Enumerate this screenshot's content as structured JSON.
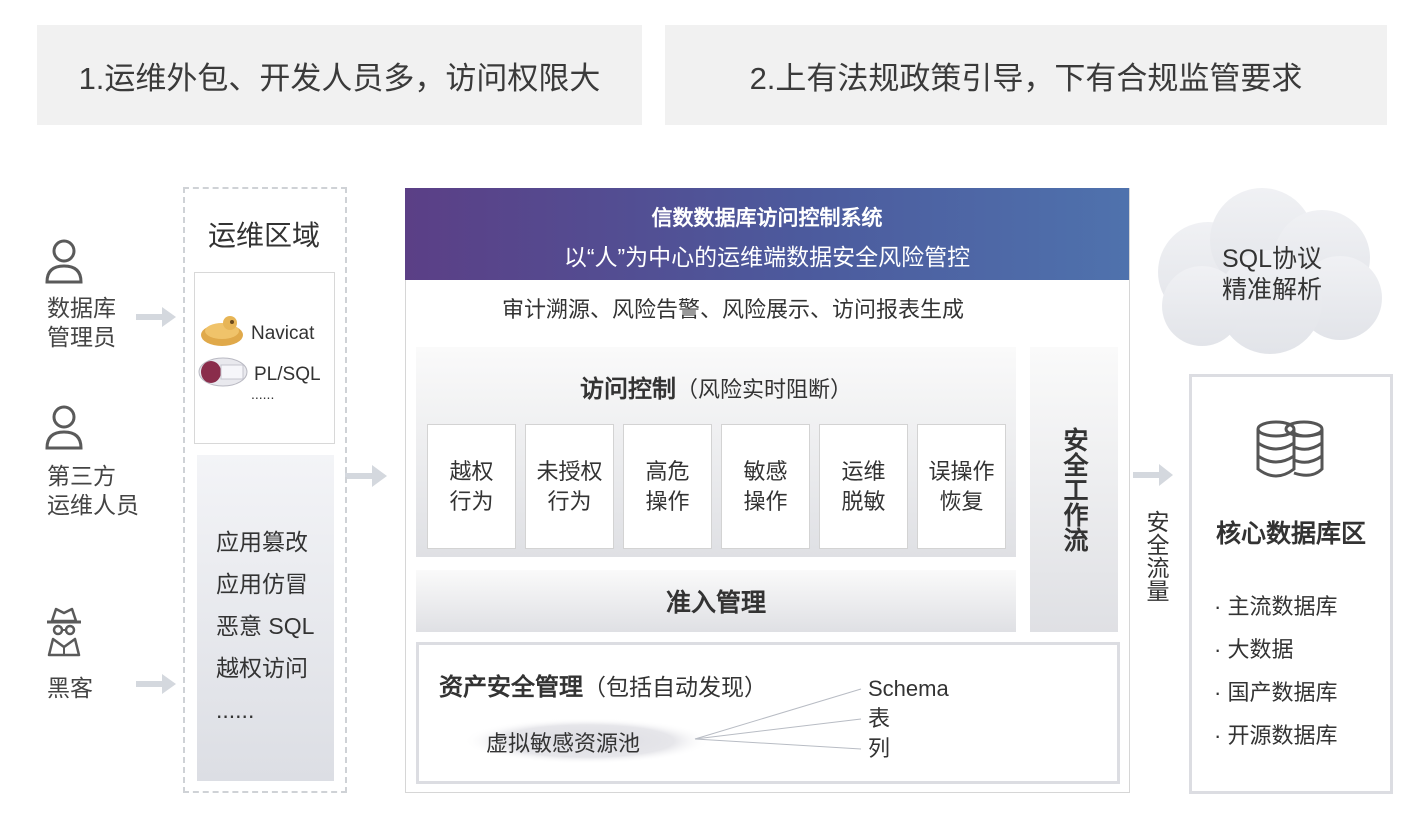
{
  "header": {
    "left_text": "1.运维外包、开发人员多，访问权限大",
    "right_text": "2.上有法规政策引导，下有合规监管要求"
  },
  "users": [
    {
      "label_line1": "数据库",
      "label_line2": "管理员",
      "icon": "person-icon"
    },
    {
      "label_line1": "第三方",
      "label_line2": "运维人员",
      "icon": "person-icon"
    },
    {
      "label_line1": "黑客",
      "label_line2": "",
      "icon": "hacker-icon"
    }
  ],
  "ops_region": {
    "title": "运维区域",
    "tools": [
      "Navicat",
      "PL/SQL",
      "......"
    ],
    "threats": [
      "应用篡改",
      "应用仿冒",
      "恶意 SQL",
      "越权访问",
      "......"
    ]
  },
  "system": {
    "title": "信数数据库访问控制系统",
    "subtitle": "以“人”为中心的运维端数据安全风险管控",
    "functions": "审计溯源、风险告警、风险展示、访问报表生成",
    "access_control": {
      "title": "访问控制",
      "subtitle": "（风险实时阻断）",
      "items": [
        {
          "line1": "越权",
          "line2": "行为"
        },
        {
          "line1": "未授权",
          "line2": "行为"
        },
        {
          "line1": "高危",
          "line2": "操作"
        },
        {
          "line1": "敏感",
          "line2": "操作"
        },
        {
          "line1": "运维",
          "line2": "脱敏"
        },
        {
          "line1": "误操作",
          "line2": "恢复"
        }
      ]
    },
    "admission": "准入管理",
    "workflow": "安全工作流",
    "asset": {
      "title": "资产安全管理",
      "subtitle": "（包括自动发现）",
      "pool": "虚拟敏感资源池",
      "targets": [
        "Schema",
        "表",
        "列"
      ]
    }
  },
  "flow_label": "安全流量",
  "cloud": {
    "line1": "SQL协议",
    "line2": "精准解析"
  },
  "core": {
    "title": "核心数据库区",
    "items": [
      "· 主流数据库",
      "· 大数据",
      "· 国产数据库",
      "· 开源数据库"
    ]
  }
}
